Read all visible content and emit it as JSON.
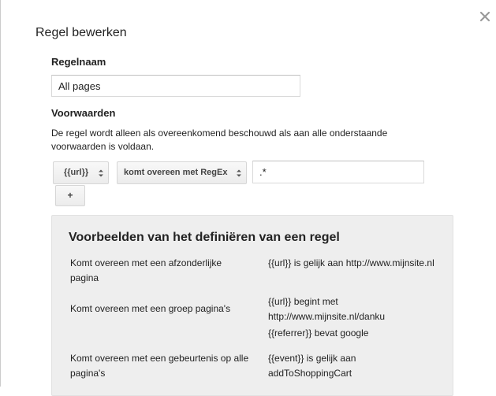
{
  "dialog": {
    "title": "Regel bewerken",
    "close_icon": "close-icon"
  },
  "rule_name": {
    "label": "Regelnaam",
    "value": "All pages"
  },
  "conditions": {
    "label": "Voorwaarden",
    "description": "De regel wordt alleen als overeenkomend beschouwd als aan alle onderstaande voorwaarden is voldaan.",
    "variable_select": "{{url}}",
    "operator_select": "komt overeen met RegEx",
    "value": ".*",
    "add_label": "+"
  },
  "examples": {
    "title": "Voorbeelden van het definiëren van een regel",
    "rows": [
      {
        "description": "Komt overeen met een afzonderlijke pagina",
        "conditions": [
          "{{url}} is gelijk aan http://www.mijnsite.nl"
        ]
      },
      {
        "description": "Komt overeen met een groep pagina's",
        "conditions": [
          "{{url}} begint met http://www.mijnsite.nl/danku",
          "{{referrer}} bevat google"
        ]
      },
      {
        "description": "Komt overeen met een gebeurtenis op alle pagina's",
        "conditions": [
          "{{event}} is gelijk aan addToShoppingCart"
        ]
      }
    ]
  },
  "colors": {
    "panel_background": "#eeeeee",
    "border": "#d9d9d9",
    "text": "#222222"
  }
}
